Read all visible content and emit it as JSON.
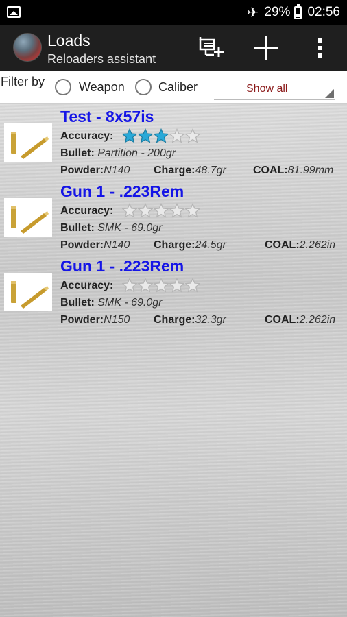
{
  "status_bar": {
    "battery": "29%",
    "time": "02:56"
  },
  "action_bar": {
    "title": "Loads",
    "subtitle": "Reloaders assistant",
    "icons": [
      "filter-add-icon",
      "add-icon",
      "overflow-menu-icon"
    ]
  },
  "filter": {
    "label": "Filter by",
    "option_weapon": "Weapon",
    "option_caliber": "Caliber",
    "selected_value": "Show all"
  },
  "loads": [
    {
      "title": "Test - 8x57is",
      "accuracy_label": "Accuracy:",
      "rating": 3,
      "bullet_label": "Bullet:",
      "bullet": "Partition - 200gr",
      "powder_label": "Powder:",
      "powder": "N140",
      "charge_label": "Charge:",
      "charge": "48.7gr",
      "coal_label": "COAL:",
      "coal": "81.99mm"
    },
    {
      "title": "Gun 1 - .223Rem",
      "accuracy_label": "Accuracy:",
      "rating": 0,
      "bullet_label": "Bullet:",
      "bullet": "SMK - 69.0gr",
      "powder_label": "Powder:",
      "powder": "N140",
      "charge_label": "Charge:",
      "charge": "24.5gr",
      "coal_label": "COAL:",
      "coal": "2.262in"
    },
    {
      "title": "Gun 1 - .223Rem",
      "accuracy_label": "Accuracy:",
      "rating": 0,
      "bullet_label": "Bullet:",
      "bullet": "SMK - 69.0gr",
      "powder_label": "Powder:",
      "powder": "N150",
      "charge_label": "Charge:",
      "charge": "32.3gr",
      "coal_label": "COAL:",
      "coal": "2.262in"
    }
  ],
  "colors": {
    "title_blue": "#1515e6",
    "star_filled": "#29a9d8",
    "star_empty": "#b5b5b5",
    "spinner_text": "#8b1a1a"
  }
}
